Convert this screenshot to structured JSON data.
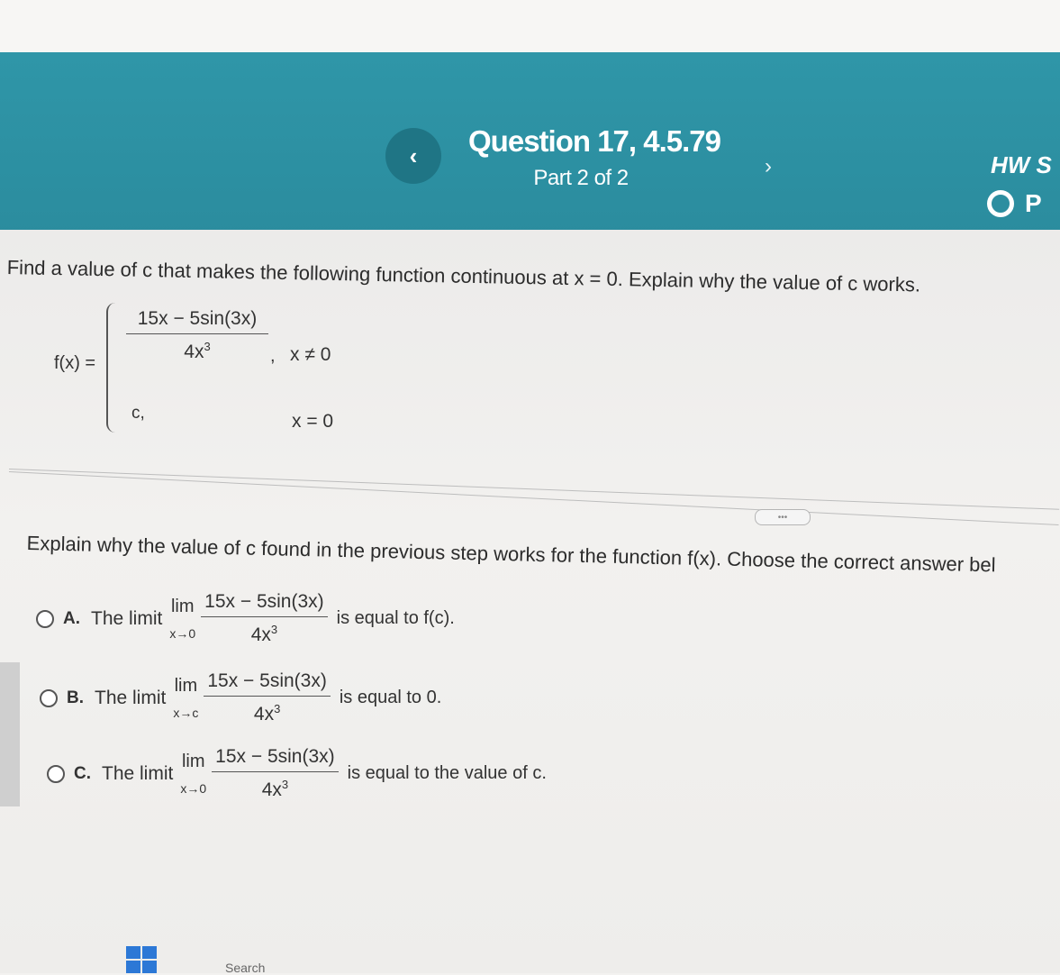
{
  "header": {
    "title": "Question 17, 4.5.79",
    "part": "Part 2 of 2",
    "hw_label": "HW S",
    "points_label": "P",
    "prev_symbol": "‹",
    "next_symbol": "›",
    "accent_color": "#2a8c9f"
  },
  "problem": {
    "instructions": "Find a value of c that makes the following function continuous at x = 0. Explain why the value of c works.",
    "function_name": "f(x) =",
    "case1_numerator": "15x − 5sin(3x)",
    "case1_denominator": "4x",
    "case1_exponent": "3",
    "case1_condition": "x ≠ 0",
    "case2_value": "c,",
    "case2_condition": "x = 0",
    "comma": ","
  },
  "divider_button_label": "•••",
  "part2": {
    "question": "Explain why the value of c found in the previous step works for the function f(x). Choose the correct answer bel",
    "options": [
      {
        "letter": "A.",
        "prefix": "The limit",
        "lim": "lim",
        "lim_sub": "x→0",
        "numerator": "15x − 5sin(3x)",
        "denominator": "4x",
        "exponent": "3",
        "suffix": "is equal to f(c)."
      },
      {
        "letter": "B.",
        "prefix": "The limit",
        "lim": "lim",
        "lim_sub": "x→c",
        "numerator": "15x − 5sin(3x)",
        "denominator": "4x",
        "exponent": "3",
        "suffix": "is equal to 0."
      },
      {
        "letter": "C.",
        "prefix": "The limit",
        "lim": "lim",
        "lim_sub": "x→0",
        "numerator": "15x − 5sin(3x)",
        "denominator": "4x",
        "exponent": "3",
        "suffix": "is equal to the value of c."
      }
    ]
  },
  "taskbar": {
    "search_hint": "Search"
  }
}
